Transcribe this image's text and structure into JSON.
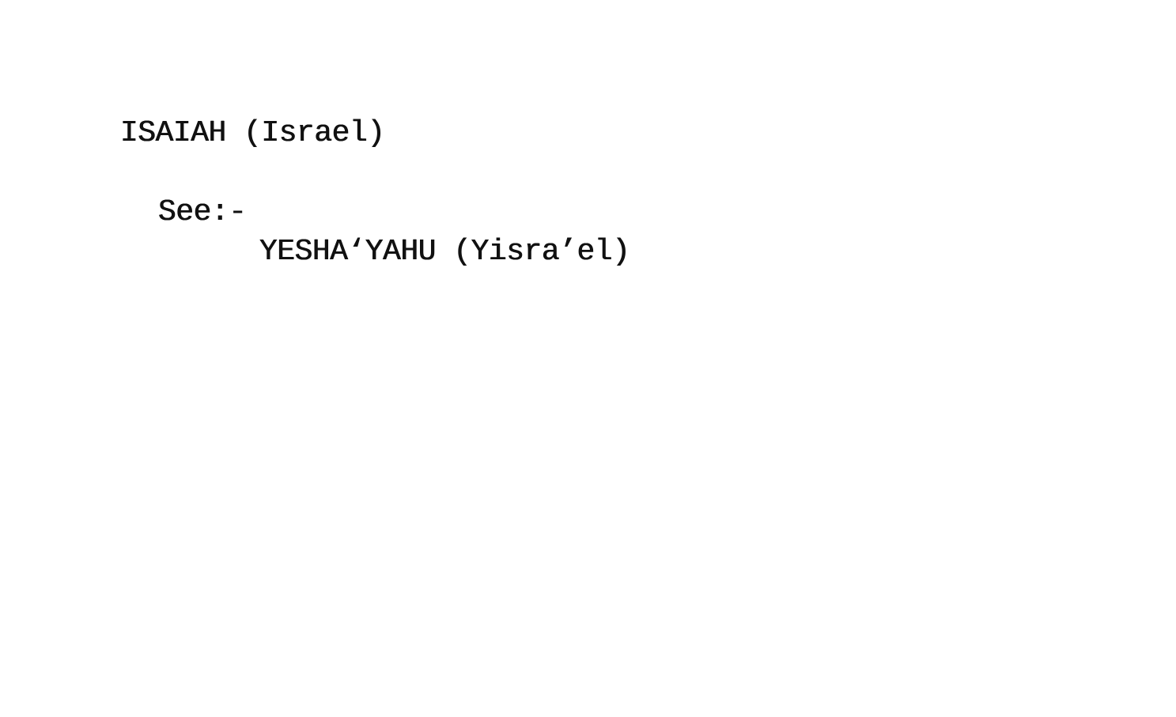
{
  "card": {
    "heading": "ISAIAH (Israel)",
    "see_label": "See:-",
    "reference": "YESHA‘YAHU (Yisra’el)"
  }
}
